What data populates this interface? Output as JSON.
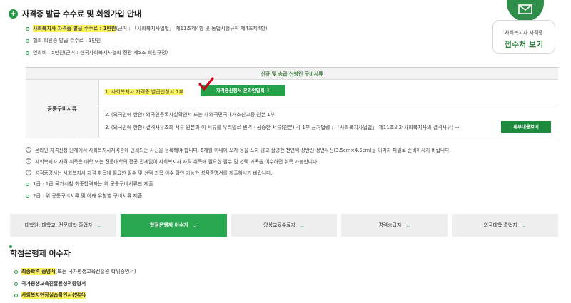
{
  "title": "자격증 발급 수수료 및 회원가입 안내",
  "fees": [
    {
      "main": "사회복지사 자격증 발급 수수료 : 1만원",
      "sub": "(근거 : 「사회복지사업법」 제11조제4항 및 동법시행규칙 제4조제4항)"
    },
    {
      "main": "협회 회원증 발급 수수료 : 1만원",
      "sub": ""
    },
    {
      "main": "연회비 : 5만원",
      "sub": "(근거 : 한국사회복지사협회 정관 제5조 회원규정)"
    }
  ],
  "reception": {
    "label": "사회복지사 자격증",
    "title": "접수처 보기"
  },
  "docs": {
    "header": "신규 및 승급 신청인 구비서류",
    "row_label": "공통구비서류",
    "line1": "1. 사회복지사 자격증 발급신청서 1부",
    "online_button": "자격증신청서 온라인입력  ⇩",
    "line2": "2. (외국인에 한함) 외국인등록사실확인서 또는 재외국민국내거소신고증 원본 1부",
    "line3": "3. (외국인에 한함) 결격사유조회 서류 원본과 이 서류를 우리말로 번역 · 공증한 서류(원본) 각 1부   근거법령 : 「사회복지사업법」 제11조의2(사회복지사의 결격사유) →",
    "detail_button": "세부내용보기"
  },
  "notes": [
    "온라인 자격신청 단계에서 사회복지사자격증에 인쇄되는 사진을 등록해야 합니다. 6개월 이내에 모자 등을 쓰지 않고 촬영한 천연색 상반신 정면사진(3.5cm×4.5cm)을 이미지 파일로 준비하시기 바랍니다.",
    "사회복지사 자격 취득은 대학 또는 전문대학의 전공 관계없이 사회복지사 자격 취득에 필요한 필수 및 선택 과목을 이수하면 취득 가능합니다.",
    "성적증명서는 사회복지사 자격 취득에 필요한 필수 및 선택 과목 이수 확인 가능한 성적증명서를 제출하시기 바랍니다."
  ],
  "grades": [
    "1급 : 1급 국가시험 최종합격자는 위 공통구비서류만 제출",
    "2급 : 위 공통구비서류 및 아래 유형별 구비서류 제출"
  ],
  "tabs": [
    {
      "label": "대학원, 대학교, 전문대학 졸업자",
      "active": false
    },
    {
      "label": "학점은행제 이수자",
      "active": true
    },
    {
      "label": "양성교육수료자",
      "active": false
    },
    {
      "label": "경력승급자",
      "active": false
    },
    {
      "label": "외국대학 졸업자",
      "active": false
    }
  ],
  "section": {
    "title": "학점은행제 이수자",
    "items": [
      {
        "main": "최종학력 증명서",
        "sub": "(또는 국가평생교육진흥원 학위증명서)",
        "highlight": true
      },
      {
        "main": "국가평생교육진흥원성적증명서",
        "sub": "",
        "highlight": false
      },
      {
        "main": "사회복지현장실습확인서(원본)",
        "sub": "",
        "highlight": true
      }
    ]
  },
  "colors": {
    "accent": "#2aa84f",
    "highlight": "#fff45c",
    "check": "#d0021b"
  }
}
